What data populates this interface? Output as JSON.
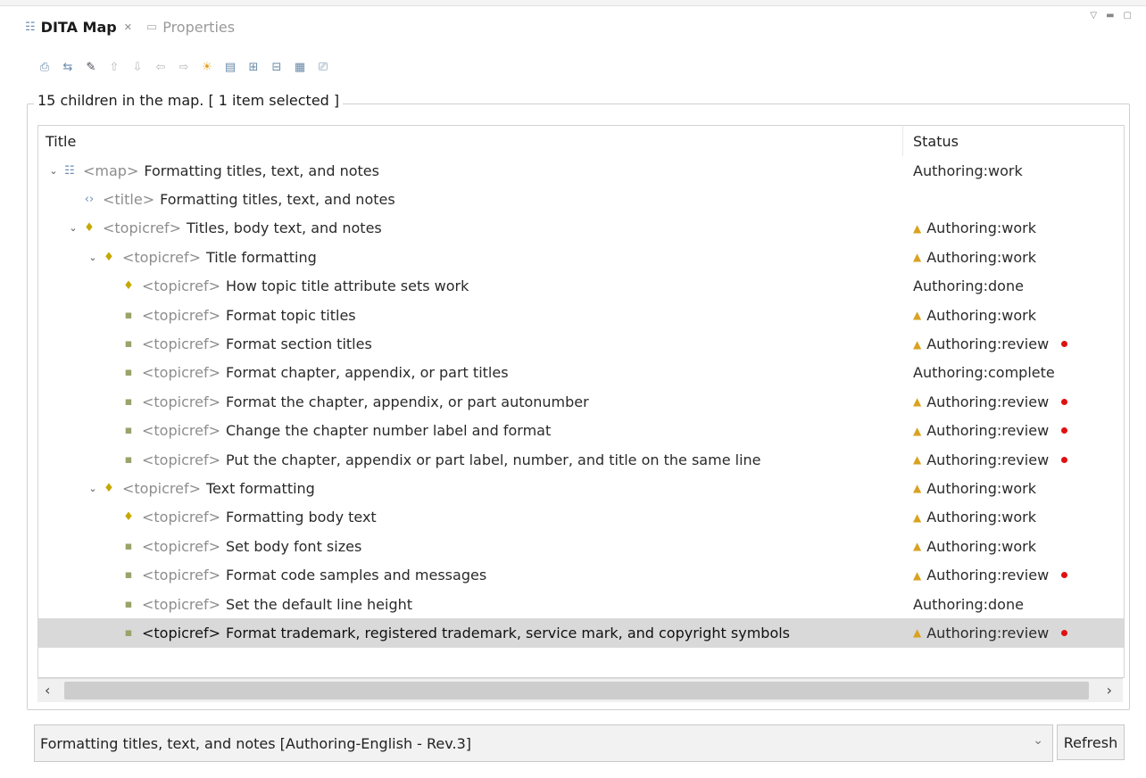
{
  "tabs": [
    {
      "label": "DITA Map",
      "active": true
    },
    {
      "label": "Properties",
      "active": false
    }
  ],
  "toolbar": {
    "icons": [
      "export-map-icon",
      "import-map-icon",
      "search-icon",
      "move-up-icon",
      "move-down-icon",
      "move-left-icon",
      "move-right-icon",
      "status-sun-icon",
      "new-topic-icon",
      "insert-child-icon",
      "collapse-icon",
      "properties-icon",
      "print-icon"
    ]
  },
  "group": {
    "legend": "15 children in the map. [ 1 item selected ]"
  },
  "table": {
    "headers": {
      "title": "Title",
      "status": "Status"
    },
    "rows": [
      {
        "level": 0,
        "expand": true,
        "icon": "map",
        "tag": "<map>",
        "label": "Formatting titles, text, and notes",
        "status": "Authoring:work",
        "warn": false,
        "dot": false
      },
      {
        "level": 1,
        "expand": false,
        "icon": "title",
        "tag": "<title>",
        "label": "Formatting titles, text, and notes",
        "status": "",
        "warn": false,
        "dot": false
      },
      {
        "level": 1,
        "expand": true,
        "icon": "bulb",
        "tag": "<topicref>",
        "label": "Titles, body text, and notes",
        "status": "Authoring:work",
        "warn": true,
        "dot": false
      },
      {
        "level": 2,
        "expand": true,
        "icon": "bulb",
        "tag": "<topicref>",
        "label": "Title formatting",
        "status": "Authoring:work",
        "warn": true,
        "dot": false
      },
      {
        "level": 3,
        "expand": false,
        "icon": "bulb",
        "tag": "<topicref>",
        "label": "How topic title attribute sets work",
        "status": "Authoring:done",
        "warn": false,
        "dot": false
      },
      {
        "level": 3,
        "expand": false,
        "icon": "doc",
        "tag": "<topicref>",
        "label": "Format topic titles",
        "status": "Authoring:work",
        "warn": true,
        "dot": false
      },
      {
        "level": 3,
        "expand": false,
        "icon": "doc",
        "tag": "<topicref>",
        "label": "Format section titles",
        "status": "Authoring:review",
        "warn": true,
        "dot": true
      },
      {
        "level": 3,
        "expand": false,
        "icon": "doc",
        "tag": "<topicref>",
        "label": "Format chapter, appendix, or part titles",
        "status": "Authoring:complete",
        "warn": false,
        "dot": false
      },
      {
        "level": 3,
        "expand": false,
        "icon": "doc",
        "tag": "<topicref>",
        "label": "Format the chapter, appendix, or part autonumber",
        "status": "Authoring:review",
        "warn": true,
        "dot": true
      },
      {
        "level": 3,
        "expand": false,
        "icon": "doc",
        "tag": "<topicref>",
        "label": "Change the chapter number label and format",
        "status": "Authoring:review",
        "warn": true,
        "dot": true
      },
      {
        "level": 3,
        "expand": false,
        "icon": "doc",
        "tag": "<topicref>",
        "label": "Put the chapter, appendix or part label, number, and title on the same line",
        "status": "Authoring:review",
        "warn": true,
        "dot": true
      },
      {
        "level": 2,
        "expand": true,
        "icon": "bulb",
        "tag": "<topicref>",
        "label": "Text formatting",
        "status": "Authoring:work",
        "warn": true,
        "dot": false
      },
      {
        "level": 3,
        "expand": false,
        "icon": "bulb",
        "tag": "<topicref>",
        "label": "Formatting body text",
        "status": "Authoring:work",
        "warn": true,
        "dot": false
      },
      {
        "level": 3,
        "expand": false,
        "icon": "doc",
        "tag": "<topicref>",
        "label": "Set body font sizes",
        "status": "Authoring:work",
        "warn": true,
        "dot": false
      },
      {
        "level": 3,
        "expand": false,
        "icon": "doc",
        "tag": "<topicref>",
        "label": "Format code samples and messages",
        "status": "Authoring:review",
        "warn": true,
        "dot": true
      },
      {
        "level": 3,
        "expand": false,
        "icon": "doc",
        "tag": "<topicref>",
        "label": "Set the default line height",
        "status": "Authoring:done",
        "warn": false,
        "dot": false
      },
      {
        "level": 3,
        "expand": false,
        "icon": "doc",
        "tag": "<topicref>",
        "label": "Format trademark, registered trademark, service mark, and copyright symbols",
        "status": "Authoring:review",
        "warn": true,
        "dot": true,
        "selected": true
      }
    ]
  },
  "bottom": {
    "combo_value": "Formatting titles, text, and notes [Authoring-English - Rev.3]",
    "refresh_label": "Refresh"
  }
}
